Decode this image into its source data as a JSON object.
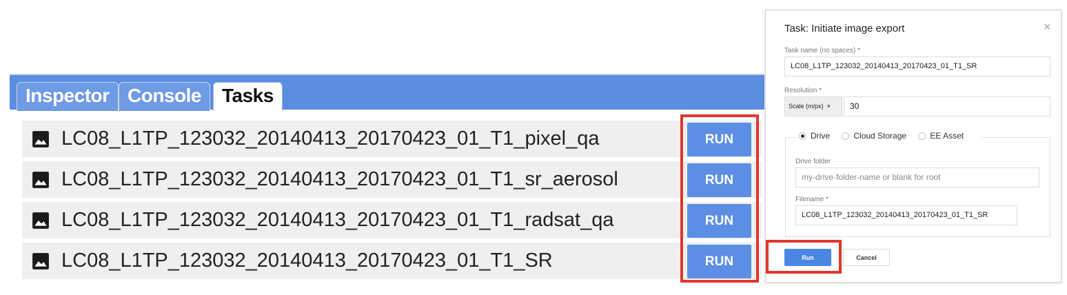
{
  "tasks_panel": {
    "tabs": [
      {
        "label": "Inspector",
        "active": false
      },
      {
        "label": "Console",
        "active": false
      },
      {
        "label": "Tasks",
        "active": true
      }
    ],
    "tasks": [
      {
        "name": "LC08_L1TP_123032_20140413_20170423_01_T1_pixel_qa",
        "icon": "image-icon",
        "button_label": "RUN"
      },
      {
        "name": "LC08_L1TP_123032_20140413_20170423_01_T1_sr_aerosol",
        "icon": "image-icon",
        "button_label": "RUN"
      },
      {
        "name": "LC08_L1TP_123032_20140413_20170423_01_T1_radsat_qa",
        "icon": "image-icon",
        "button_label": "RUN"
      },
      {
        "name": "LC08_L1TP_123032_20140413_20170423_01_T1_SR",
        "icon": "image-icon",
        "button_label": "RUN"
      }
    ]
  },
  "export_dialog": {
    "title": "Task: Initiate image export",
    "close_icon": "×",
    "task_name": {
      "label": "Task name (no spaces) *",
      "value": "LC08_L1TP_123032_20140413_20170423_01_T1_SR"
    },
    "resolution": {
      "label": "Resolution *",
      "unit_select": "Scale (m/px)",
      "value": "30"
    },
    "destination_options": [
      {
        "label": "Drive",
        "checked": true
      },
      {
        "label": "Cloud Storage",
        "checked": false
      },
      {
        "label": "EE Asset",
        "checked": false
      }
    ],
    "drive_folder": {
      "label": "Drive folder",
      "placeholder": "my-drive-folder-name or blank for root"
    },
    "filename": {
      "label": "Filename *",
      "value": "LC08_L1TP_123032_20140413_20170423_01_T1_SR"
    },
    "run_label": "Run",
    "cancel_label": "Cancel"
  },
  "colors": {
    "tab_bar_blue": "#5b8de0",
    "run_button_blue": "#5c8ee3",
    "highlight_red": "#e2362b"
  }
}
